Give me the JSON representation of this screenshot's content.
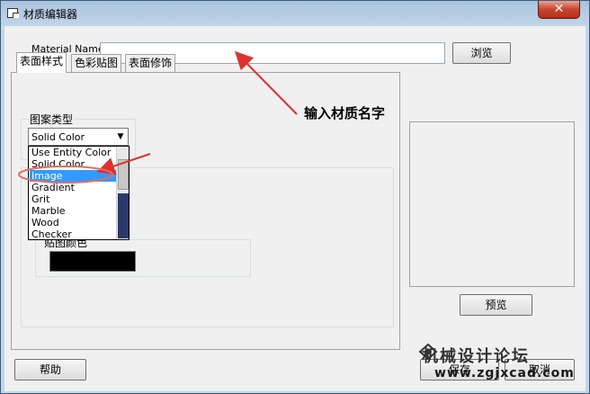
{
  "window": {
    "title": "材质编辑器",
    "close_glyph": "✕"
  },
  "form": {
    "material_name_label": "Material Name",
    "material_name_value": "",
    "browse_label": "浏览"
  },
  "tabs": [
    {
      "label": "表面样式",
      "active": true
    },
    {
      "label": "色彩贴图",
      "active": false
    },
    {
      "label": "表面修饰",
      "active": false
    }
  ],
  "pattern_group": {
    "title": "图案类型",
    "selected": "Solid Color",
    "options": [
      "Use Entity Color",
      "Solid Color",
      "Image",
      "Gradient",
      "Grit",
      "Marble",
      "Wood",
      "Checker"
    ],
    "highlighted": "Image"
  },
  "color_group": {
    "title": "贴图颜色",
    "swatch_color": "#000000"
  },
  "buttons": {
    "preview_label": "预览",
    "help_label": "帮助",
    "save_label": "保存",
    "cancel_label": "取消"
  },
  "annotations": {
    "hint_text": "输入材质名字",
    "arrow_color": "#e03030"
  },
  "watermark": {
    "text": "机械设计论坛",
    "url": "www.zgjxcad.com"
  },
  "icons": {
    "title": "window-icon",
    "combo": "chevron-down-icon",
    "logo": "diamond-logo-icon"
  }
}
